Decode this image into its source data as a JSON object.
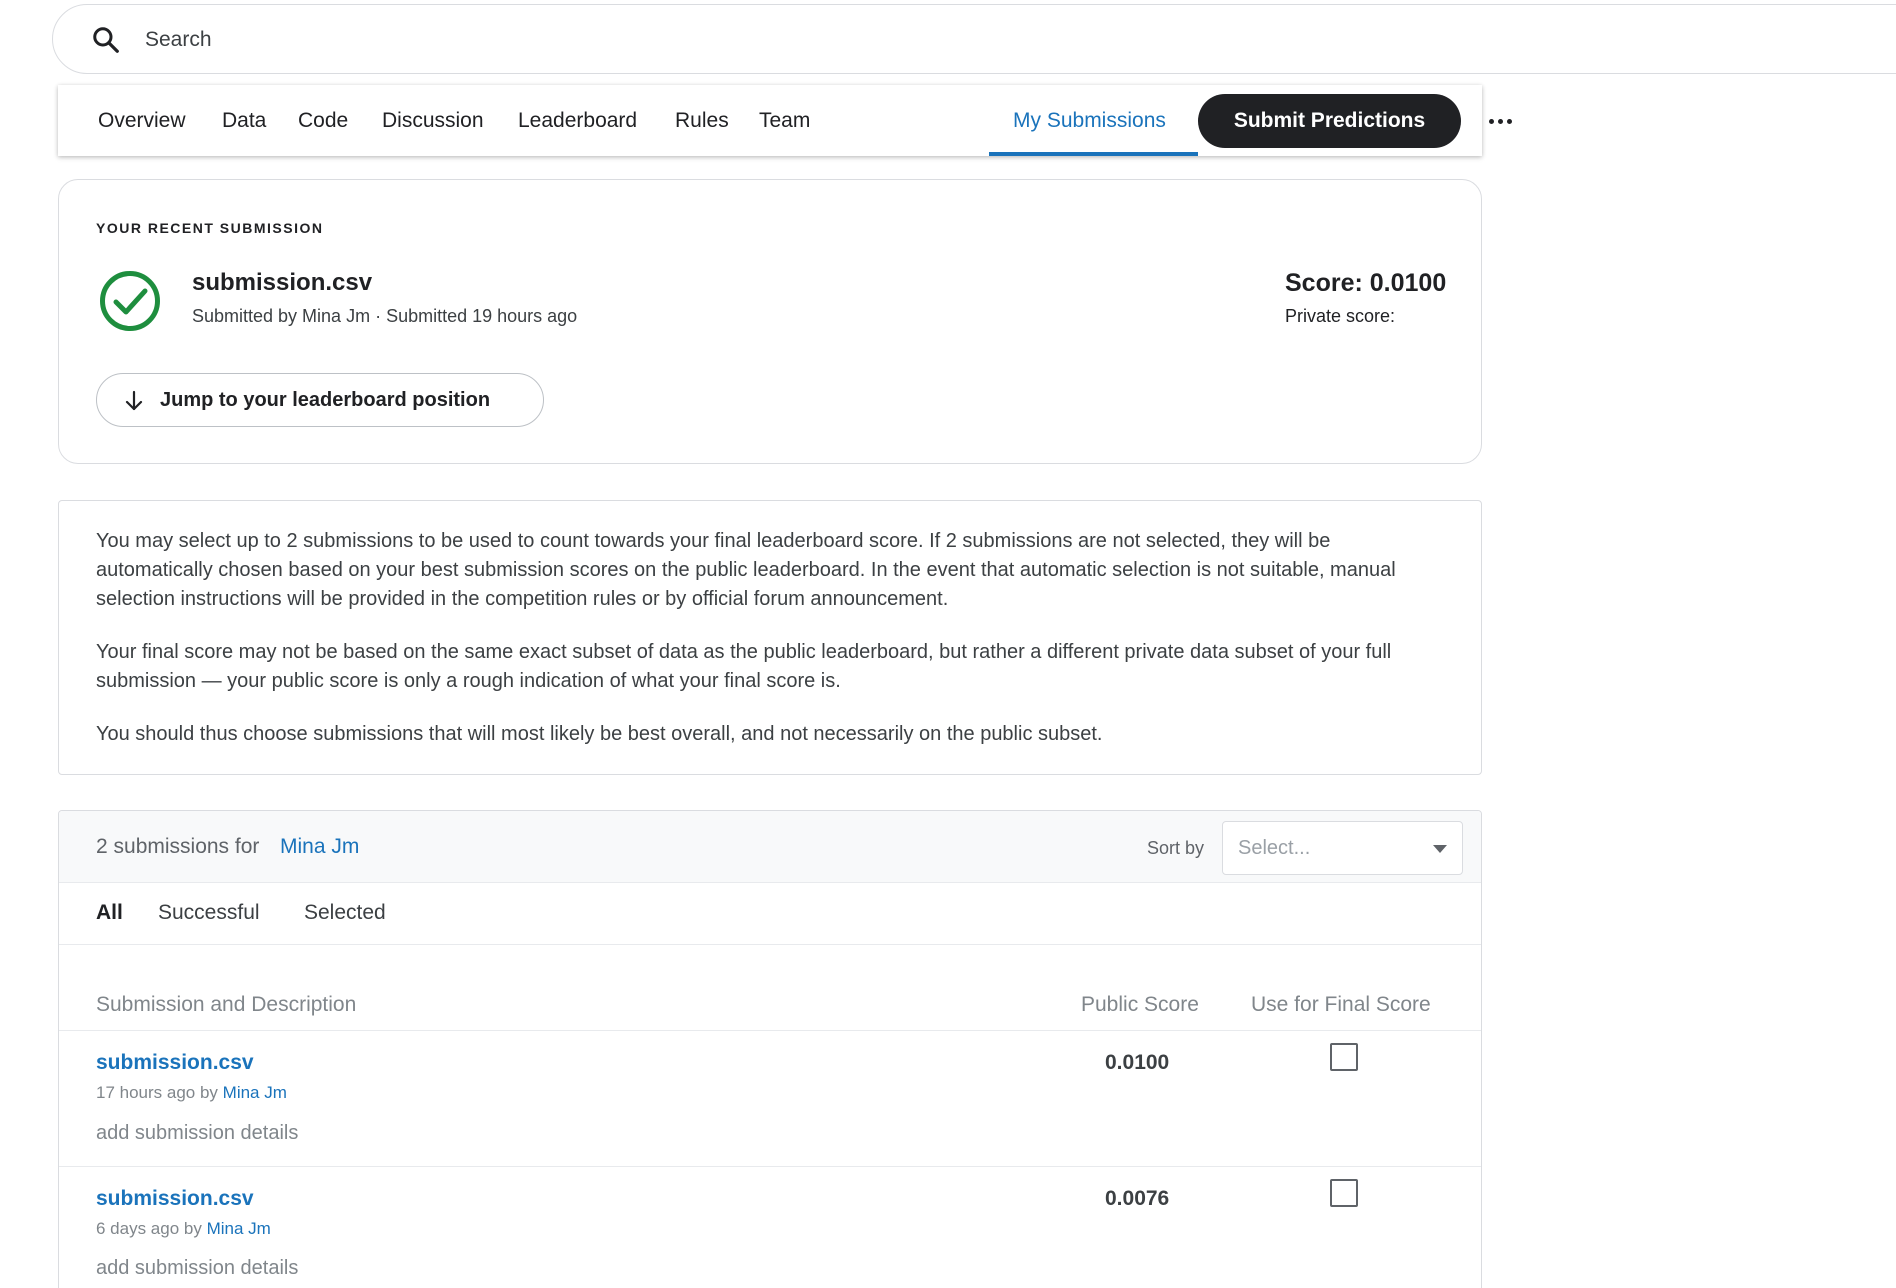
{
  "search": {
    "placeholder": "Search"
  },
  "nav": {
    "tabs": [
      "Overview",
      "Data",
      "Code",
      "Discussion",
      "Leaderboard",
      "Rules",
      "Team"
    ],
    "active_tab": "My Submissions",
    "submit_label": "Submit Predictions",
    "accent": "#1a73bb"
  },
  "recent": {
    "heading": "YOUR RECENT SUBMISSION",
    "file": "submission.csv",
    "meta": "Submitted by Mina Jm · Submitted 19 hours ago",
    "score": "Score: 0.0100",
    "private_score": "Private score:",
    "jump_label": "Jump to your leaderboard position",
    "status_color": "#1e8e3e"
  },
  "info": {
    "paragraphs": [
      "You may select up to 2 submissions to be used to count towards your final leaderboard score. If 2 submissions are not selected, they will be automatically chosen based on your best submission scores on the public leaderboard. In the event that automatic selection is not suitable, manual selection instructions will be provided in the competition rules or by official forum announcement.",
      "Your final score may not be based on the same exact subset of data as the public leaderboard, but rather a different private data subset of your full submission — your public score is only a rough indication of what your final score is.",
      "You should thus choose submissions that will most likely be best overall, and not necessarily on the public subset."
    ]
  },
  "submissions": {
    "count_label": "2 submissions for",
    "user": "Mina Jm",
    "sort_label": "Sort by",
    "sort_value": "Select...",
    "filters": [
      "All",
      "Successful",
      "Selected"
    ],
    "active_filter": "All",
    "columns": [
      "Submission and Description",
      "Public Score",
      "Use for Final Score"
    ],
    "rows": [
      {
        "file": "submission.csv",
        "time": "17 hours ago by",
        "user": "Mina Jm",
        "details": "add submission details",
        "score": "0.0100",
        "selected": false
      },
      {
        "file": "submission.csv",
        "time": "6 days ago by",
        "user": "Mina Jm",
        "details": "add submission details",
        "score": "0.0076",
        "selected": false
      }
    ]
  }
}
